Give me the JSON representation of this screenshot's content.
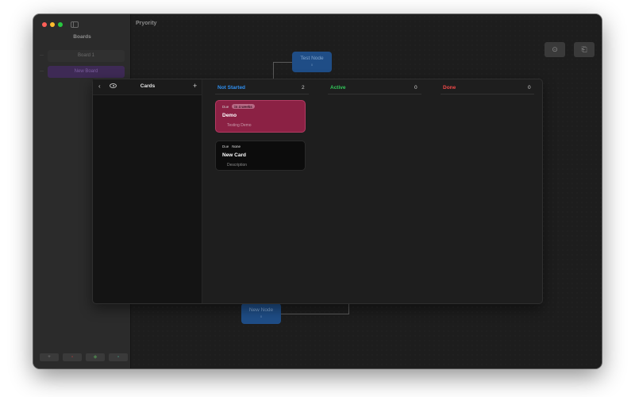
{
  "app": {
    "title": "Pryority"
  },
  "sidebar": {
    "heading": "Boards",
    "items": [
      {
        "label": "Board 1",
        "marker": "—"
      },
      {
        "label": "New Board",
        "marker": "—"
      }
    ],
    "buttons": [
      {
        "icon": "plus-icon",
        "glyph": "+"
      },
      {
        "icon": "trash-icon",
        "glyph": "▪"
      },
      {
        "icon": "tag-icon",
        "glyph": "◆"
      },
      {
        "icon": "settings-icon",
        "glyph": "▪"
      }
    ]
  },
  "toolbar": {
    "buttons": [
      {
        "icon": "download-icon",
        "glyph": "⊙"
      },
      {
        "icon": "export-icon",
        "glyph": "⎗"
      }
    ]
  },
  "canvas": {
    "nodes": [
      {
        "label": "Test Node",
        "sub": "0"
      },
      {
        "label": "New Node",
        "sub": "0"
      }
    ]
  },
  "panel": {
    "sidebar": {
      "title": "Cards",
      "back_glyph": "‹",
      "add_glyph": "+"
    },
    "columns": [
      {
        "label": "Not Started",
        "count": "2",
        "color": "#2f8ff0"
      },
      {
        "label": "Active",
        "count": "0",
        "color": "#32c85a"
      },
      {
        "label": "Done",
        "count": "0",
        "color": "#f04848"
      }
    ],
    "cards": [
      {
        "due_label": "Due",
        "due_value": "in 4 weeks",
        "title": "Demo",
        "description": "Testing Demo",
        "color": "#8b2144"
      },
      {
        "due_label": "Due",
        "due_value": "None",
        "title": "New Card",
        "description": "Description",
        "color": "#0c0c0c"
      }
    ]
  }
}
